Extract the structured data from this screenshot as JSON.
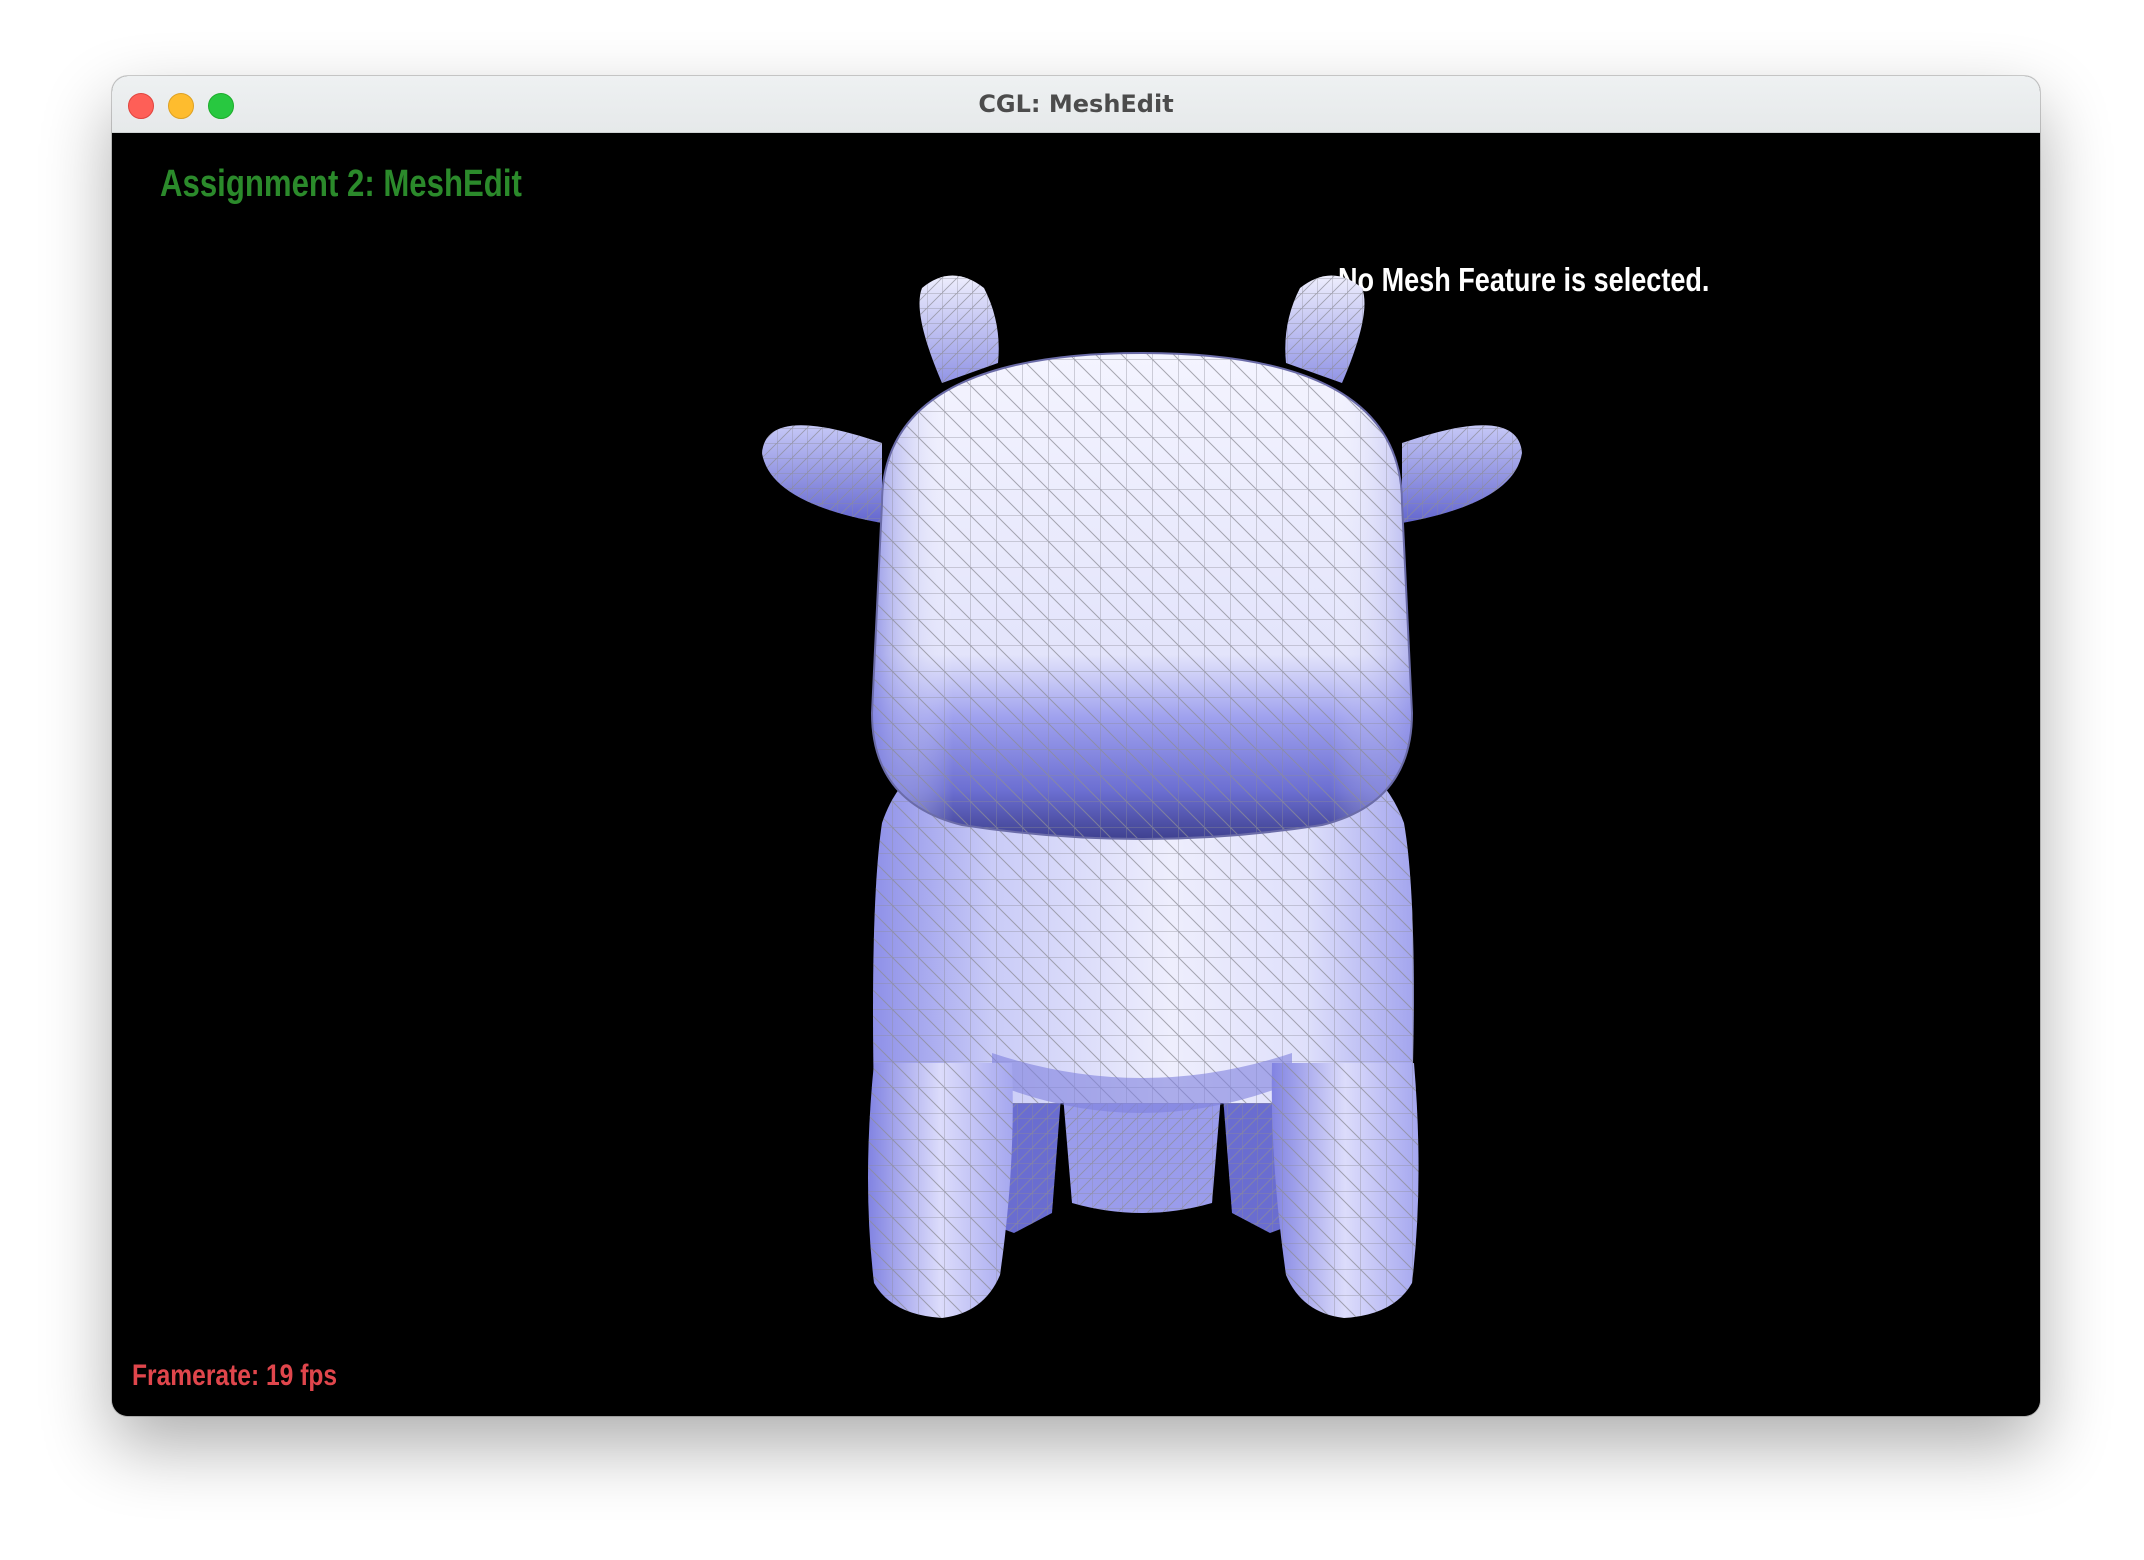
{
  "window": {
    "title": "CGL: MeshEdit"
  },
  "viewport": {
    "heading": "Assignment 2: MeshEdit",
    "selection_status": "No Mesh Feature is selected.",
    "framerate": "Framerate: 19 fps"
  },
  "colors": {
    "heading": "#2b8a2b",
    "framerate": "#e0464c",
    "mesh_light": "#f4f4ff",
    "mesh_mid": "#a4a6f2",
    "mesh_dark": "#5558c0",
    "wire": "#8c8c96"
  }
}
